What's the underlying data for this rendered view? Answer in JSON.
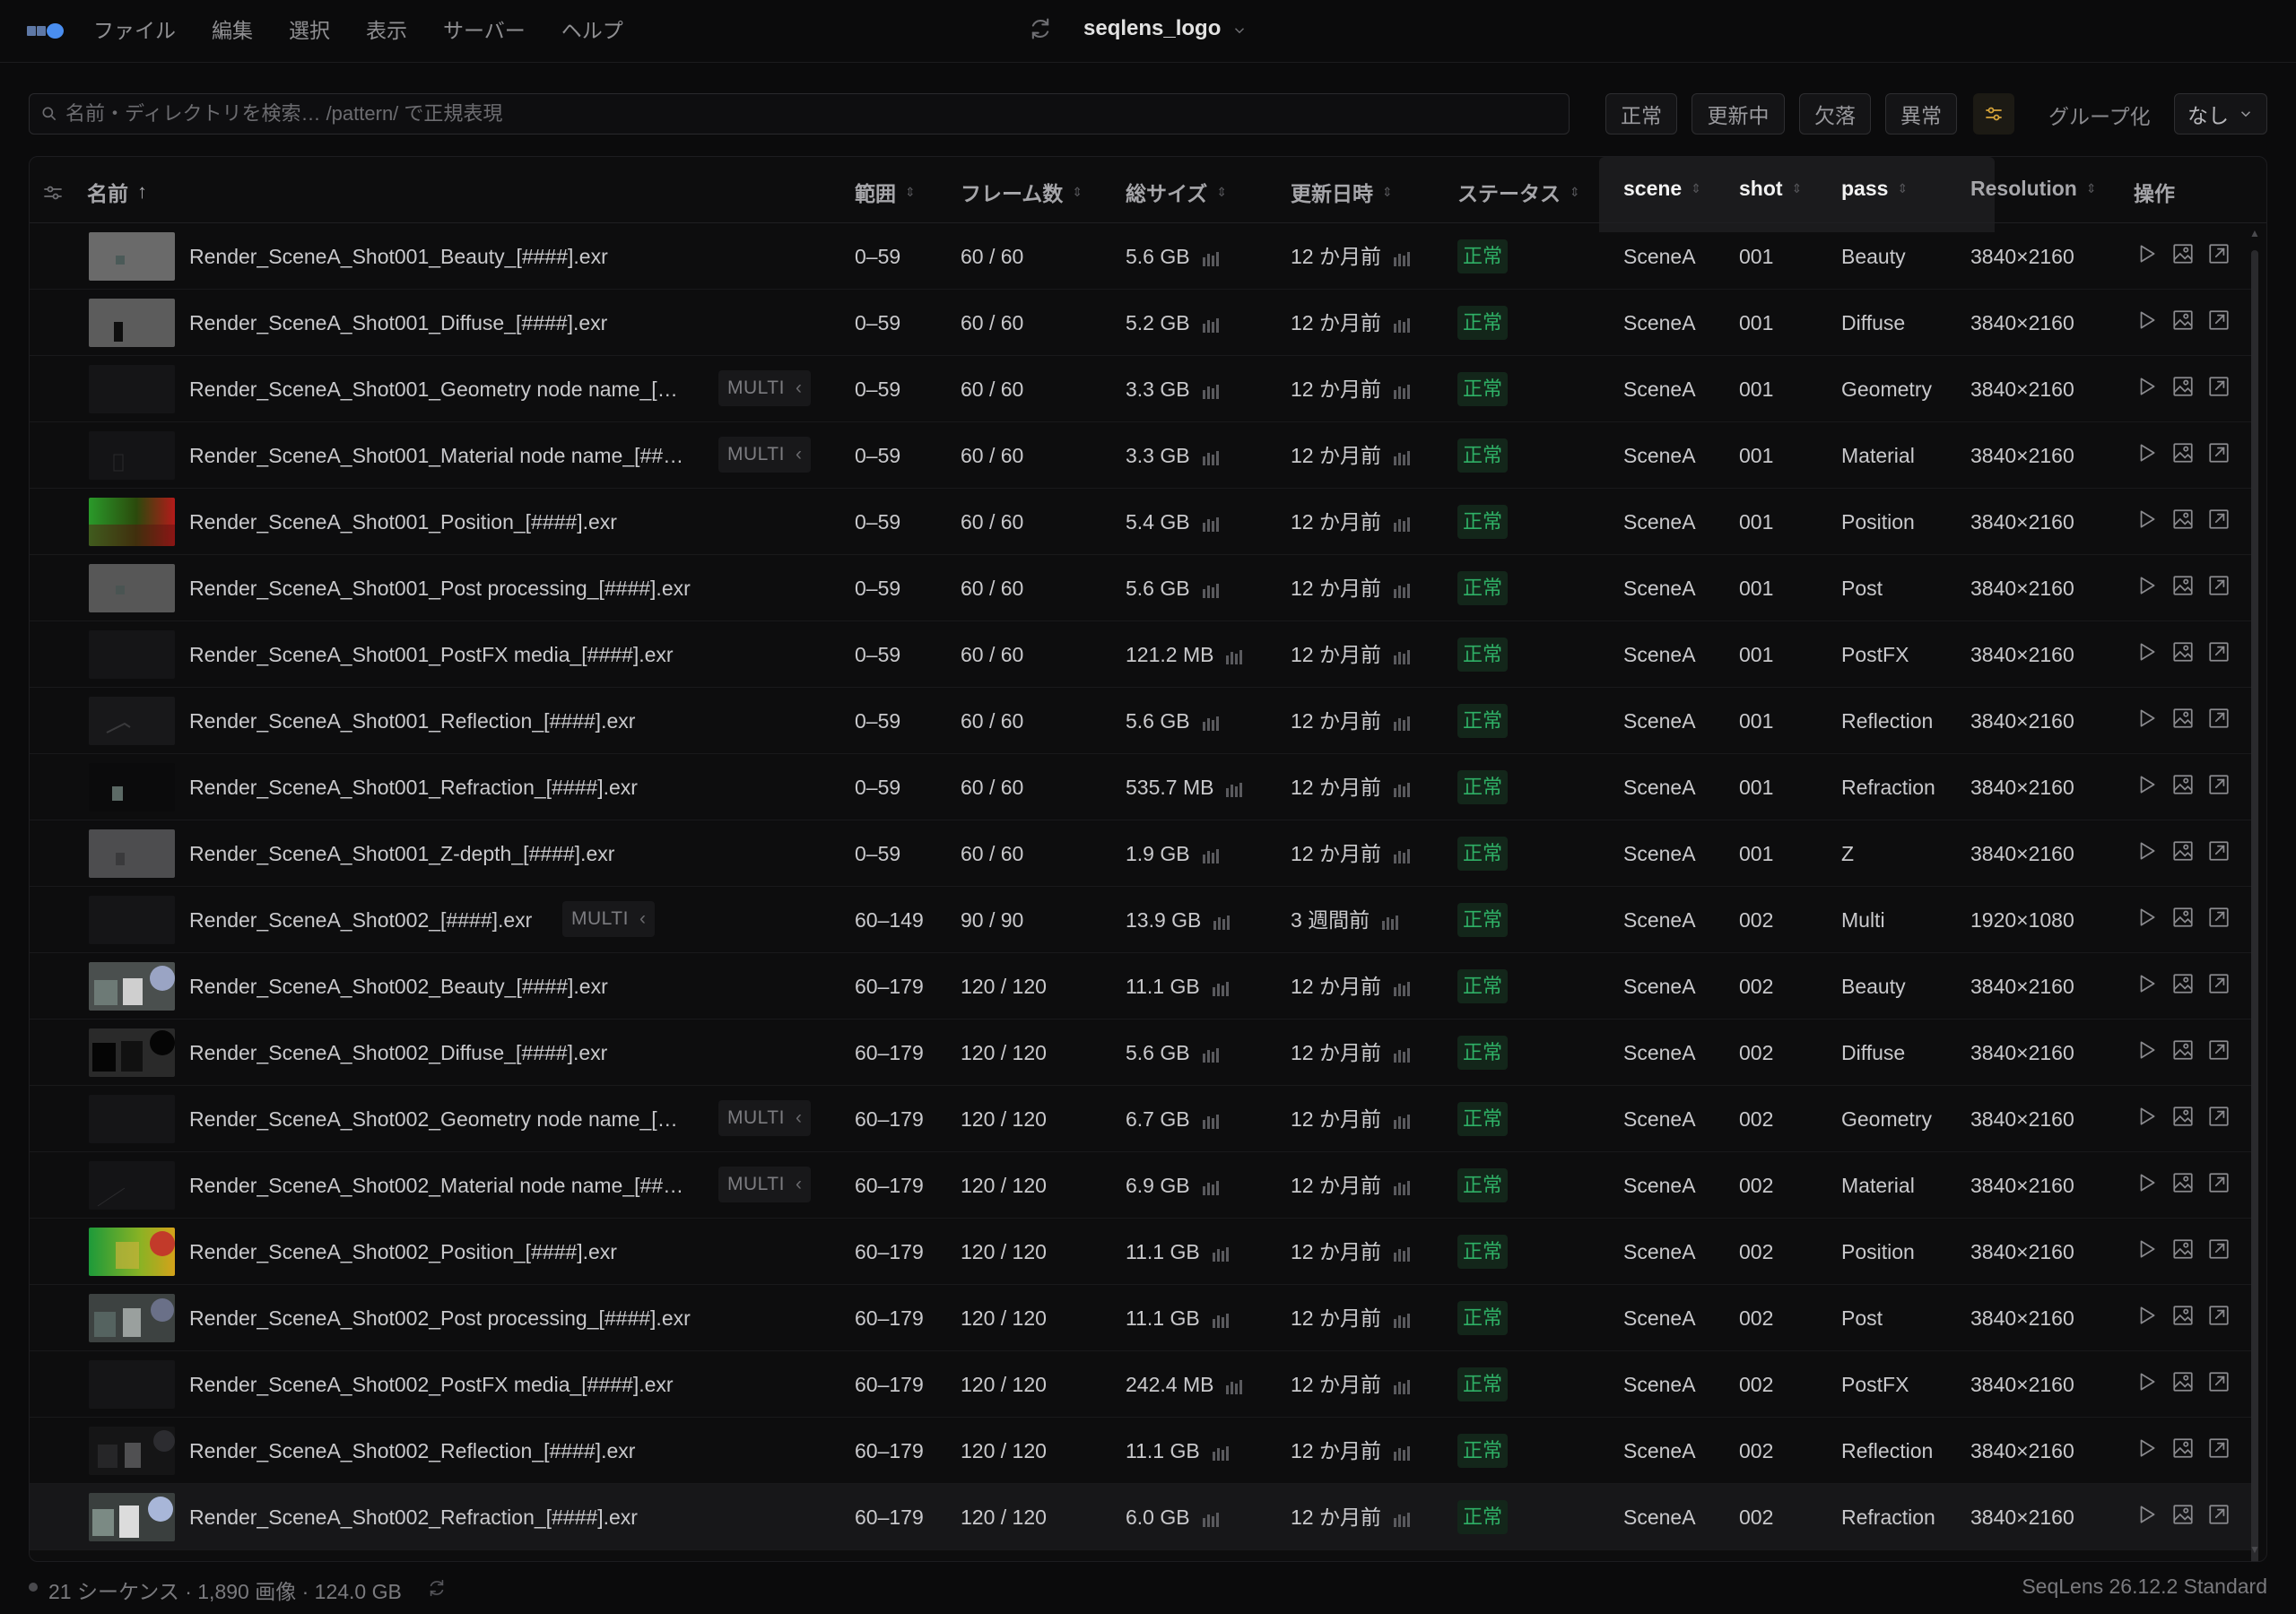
{
  "menubar": {
    "items": [
      "ファイル",
      "編集",
      "選択",
      "表示",
      "サーバー",
      "ヘルプ"
    ],
    "title": "seqlens_logo"
  },
  "filterbar": {
    "search_placeholder": "名前・ディレクトリを検索… /pattern/ で正規表現",
    "status_chips": [
      "正常",
      "更新中",
      "欠落",
      "異常"
    ],
    "group_label": "グループ化",
    "group_value": "なし"
  },
  "table": {
    "columns": {
      "name": "名前",
      "range": "範囲",
      "frames": "フレーム数",
      "size": "総サイズ",
      "modified": "更新日時",
      "status": "ステータス",
      "scene": "scene",
      "shot": "shot",
      "pass": "pass",
      "resolution": "Resolution",
      "actions": "操作"
    },
    "multi_label": "MULTI",
    "rows": [
      {
        "name": "Render_SceneA_Shot001_Beauty_[####].exr",
        "multi": false,
        "range": "0–59",
        "frames": "60 / 60",
        "size": "5.6 GB",
        "modified": "12 か月前",
        "status": "正常",
        "scene": "SceneA",
        "shot": "001",
        "pass": "Beauty",
        "resolution": "3840×2160",
        "thumb": "gray"
      },
      {
        "name": "Render_SceneA_Shot001_Diffuse_[####].exr",
        "multi": false,
        "range": "0–59",
        "frames": "60 / 60",
        "size": "5.2 GB",
        "modified": "12 か月前",
        "status": "正常",
        "scene": "SceneA",
        "shot": "001",
        "pass": "Diffuse",
        "resolution": "3840×2160",
        "thumb": "diffuse"
      },
      {
        "name": "Render_SceneA_Shot001_Geometry node name_[…",
        "multi": true,
        "range": "0–59",
        "frames": "60 / 60",
        "size": "3.3 GB",
        "modified": "12 か月前",
        "status": "正常",
        "scene": "SceneA",
        "shot": "001",
        "pass": "Geometry",
        "resolution": "3840×2160",
        "thumb": "dark"
      },
      {
        "name": "Render_SceneA_Shot001_Material node name_[##…",
        "multi": true,
        "range": "0–59",
        "frames": "60 / 60",
        "size": "3.3 GB",
        "modified": "12 か月前",
        "status": "正常",
        "scene": "SceneA",
        "shot": "001",
        "pass": "Material",
        "resolution": "3840×2160",
        "thumb": "darkbox"
      },
      {
        "name": "Render_SceneA_Shot001_Position_[####].exr",
        "multi": false,
        "range": "0–59",
        "frames": "60 / 60",
        "size": "5.4 GB",
        "modified": "12 か月前",
        "status": "正常",
        "scene": "SceneA",
        "shot": "001",
        "pass": "Position",
        "resolution": "3840×2160",
        "thumb": "position"
      },
      {
        "name": "Render_SceneA_Shot001_Post processing_[####].exr",
        "multi": false,
        "range": "0–59",
        "frames": "60 / 60",
        "size": "5.6 GB",
        "modified": "12 か月前",
        "status": "正常",
        "scene": "SceneA",
        "shot": "001",
        "pass": "Post",
        "resolution": "3840×2160",
        "thumb": "gray2"
      },
      {
        "name": "Render_SceneA_Shot001_PostFX media_[####].exr",
        "multi": false,
        "range": "0–59",
        "frames": "60 / 60",
        "size": "121.2 MB",
        "modified": "12 か月前",
        "status": "正常",
        "scene": "SceneA",
        "shot": "001",
        "pass": "PostFX",
        "resolution": "3840×2160",
        "thumb": "dark"
      },
      {
        "name": "Render_SceneA_Shot001_Reflection_[####].exr",
        "multi": false,
        "range": "0–59",
        "frames": "60 / 60",
        "size": "5.6 GB",
        "modified": "12 か月前",
        "status": "正常",
        "scene": "SceneA",
        "shot": "001",
        "pass": "Reflection",
        "resolution": "3840×2160",
        "thumb": "reflection"
      },
      {
        "name": "Render_SceneA_Shot001_Refraction_[####].exr",
        "multi": false,
        "range": "0–59",
        "frames": "60 / 60",
        "size": "535.7 MB",
        "modified": "12 か月前",
        "status": "正常",
        "scene": "SceneA",
        "shot": "001",
        "pass": "Refraction",
        "resolution": "3840×2160",
        "thumb": "refraction"
      },
      {
        "name": "Render_SceneA_Shot001_Z-depth_[####].exr",
        "multi": false,
        "range": "0–59",
        "frames": "60 / 60",
        "size": "1.9 GB",
        "modified": "12 か月前",
        "status": "正常",
        "scene": "SceneA",
        "shot": "001",
        "pass": "Z",
        "resolution": "3840×2160",
        "thumb": "zdepth"
      },
      {
        "name": "Render_SceneA_Shot002_[####].exr",
        "multi": true,
        "range": "60–149",
        "frames": "90 / 90",
        "size": "13.9 GB",
        "modified": "3 週間前",
        "status": "正常",
        "scene": "SceneA",
        "shot": "002",
        "pass": "Multi",
        "resolution": "1920×1080",
        "thumb": "dark"
      },
      {
        "name": "Render_SceneA_Shot002_Beauty_[####].exr",
        "multi": false,
        "range": "60–179",
        "frames": "120 / 120",
        "size": "11.1 GB",
        "modified": "12 か月前",
        "status": "正常",
        "scene": "SceneA",
        "shot": "002",
        "pass": "Beauty",
        "resolution": "3840×2160",
        "thumb": "beauty2"
      },
      {
        "name": "Render_SceneA_Shot002_Diffuse_[####].exr",
        "multi": false,
        "range": "60–179",
        "frames": "120 / 120",
        "size": "5.6 GB",
        "modified": "12 か月前",
        "status": "正常",
        "scene": "SceneA",
        "shot": "002",
        "pass": "Diffuse",
        "resolution": "3840×2160",
        "thumb": "diffuse2"
      },
      {
        "name": "Render_SceneA_Shot002_Geometry node name_[…",
        "multi": true,
        "range": "60–179",
        "frames": "120 / 120",
        "size": "6.7 GB",
        "modified": "12 か月前",
        "status": "正常",
        "scene": "SceneA",
        "shot": "002",
        "pass": "Geometry",
        "resolution": "3840×2160",
        "thumb": "dark"
      },
      {
        "name": "Render_SceneA_Shot002_Material node name_[##…",
        "multi": true,
        "range": "60–179",
        "frames": "120 / 120",
        "size": "6.9 GB",
        "modified": "12 か月前",
        "status": "正常",
        "scene": "SceneA",
        "shot": "002",
        "pass": "Material",
        "resolution": "3840×2160",
        "thumb": "darkline"
      },
      {
        "name": "Render_SceneA_Shot002_Position_[####].exr",
        "multi": false,
        "range": "60–179",
        "frames": "120 / 120",
        "size": "11.1 GB",
        "modified": "12 か月前",
        "status": "正常",
        "scene": "SceneA",
        "shot": "002",
        "pass": "Position",
        "resolution": "3840×2160",
        "thumb": "position2"
      },
      {
        "name": "Render_SceneA_Shot002_Post processing_[####].exr",
        "multi": false,
        "range": "60–179",
        "frames": "120 / 120",
        "size": "11.1 GB",
        "modified": "12 か月前",
        "status": "正常",
        "scene": "SceneA",
        "shot": "002",
        "pass": "Post",
        "resolution": "3840×2160",
        "thumb": "post2"
      },
      {
        "name": "Render_SceneA_Shot002_PostFX media_[####].exr",
        "multi": false,
        "range": "60–179",
        "frames": "120 / 120",
        "size": "242.4 MB",
        "modified": "12 か月前",
        "status": "正常",
        "scene": "SceneA",
        "shot": "002",
        "pass": "PostFX",
        "resolution": "3840×2160",
        "thumb": "dark"
      },
      {
        "name": "Render_SceneA_Shot002_Reflection_[####].exr",
        "multi": false,
        "range": "60–179",
        "frames": "120 / 120",
        "size": "11.1 GB",
        "modified": "12 か月前",
        "status": "正常",
        "scene": "SceneA",
        "shot": "002",
        "pass": "Reflection",
        "resolution": "3840×2160",
        "thumb": "reflection2"
      },
      {
        "name": "Render_SceneA_Shot002_Refraction_[####].exr",
        "multi": false,
        "range": "60–179",
        "frames": "120 / 120",
        "size": "6.0 GB",
        "modified": "12 か月前",
        "status": "正常",
        "scene": "SceneA",
        "shot": "002",
        "pass": "Refraction",
        "resolution": "3840×2160",
        "thumb": "refraction2",
        "hover": true
      }
    ]
  },
  "footer": {
    "summary": "21 シーケンス · 1,890 画像 · 124.0 GB",
    "version": "SeqLens 26.12.2 Standard"
  },
  "colors": {
    "accent": "#4a8ef0",
    "status_ok_text": "#2fb066",
    "status_ok_bg": "#13261a",
    "highlight_column_bg": "#1b1b1d"
  }
}
